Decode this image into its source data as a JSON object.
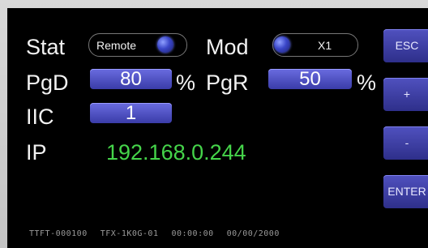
{
  "status": {
    "stat_label": "Stat",
    "stat_value": "Remote",
    "mod_label": "Mod",
    "mod_value": "X1"
  },
  "settings": {
    "pgd_label": "PgD",
    "pgd_value": "80",
    "pgd_unit": "%",
    "pgr_label": "PgR",
    "pgr_value": "50",
    "pgr_unit": "%",
    "iic_label": "IIC",
    "iic_value": "1"
  },
  "network": {
    "ip_label": "IP",
    "ip_value": "192.168.0.244"
  },
  "buttons": {
    "esc": "ESC",
    "plus": "+",
    "minus": "-",
    "enter": "ENTER"
  },
  "footer": {
    "id1": "TTFT-000100",
    "id2": "TFX-1K0G-01",
    "time": "00:00:00",
    "date": "00/00/2000"
  },
  "colors": {
    "field": "#4a4cc0",
    "ip_text": "#45d44a",
    "led": "#3a46c8",
    "background": "#000000"
  }
}
